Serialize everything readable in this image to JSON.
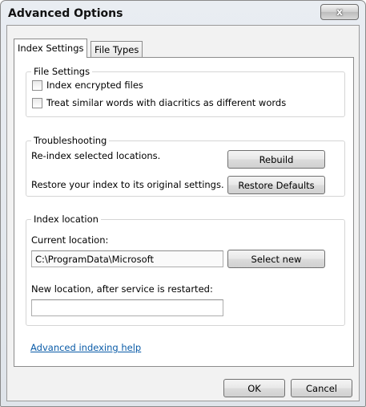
{
  "window": {
    "title": "Advanced Options",
    "close_label": "x"
  },
  "tabs": [
    {
      "label": "Index Settings",
      "active": true
    },
    {
      "label": "File Types",
      "active": false
    }
  ],
  "file_settings": {
    "title": "File Settings",
    "options": [
      {
        "label": "Index encrypted files",
        "checked": false
      },
      {
        "label": "Treat similar words with diacritics as different words",
        "checked": false
      }
    ]
  },
  "troubleshooting": {
    "title": "Troubleshooting",
    "reindex_text": "Re-index selected locations.",
    "rebuild_label": "Rebuild",
    "restore_text": "Restore your index to its original settings.",
    "restore_label": "Restore Defaults"
  },
  "index_location": {
    "title": "Index location",
    "current_label": "Current location:",
    "current_value": "C:\\ProgramData\\Microsoft",
    "select_new_label": "Select new",
    "new_label": "New location, after service is restarted:",
    "new_value": ""
  },
  "help_link": "Advanced indexing help",
  "footer": {
    "ok_label": "OK",
    "cancel_label": "Cancel"
  }
}
